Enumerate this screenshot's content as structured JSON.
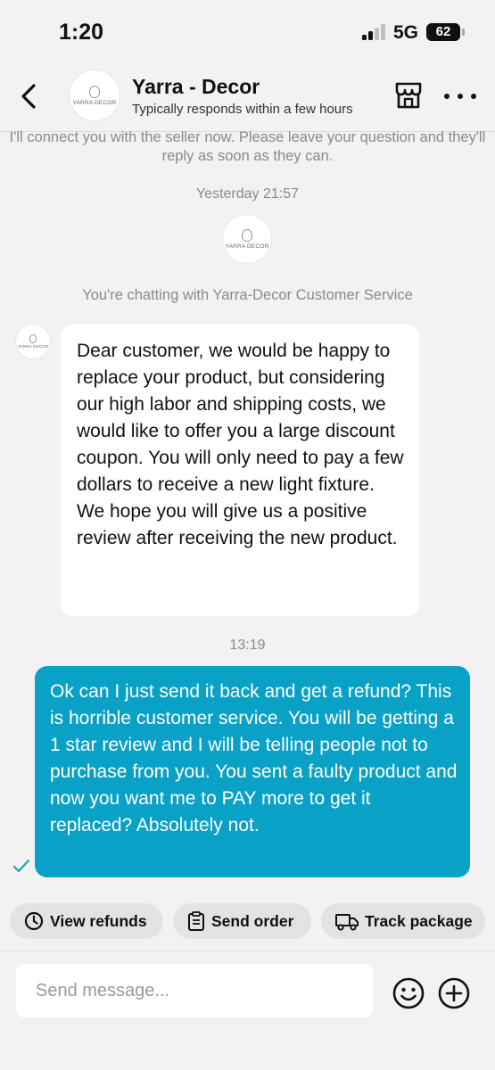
{
  "status_bar": {
    "time": "1:20",
    "network": "5G",
    "battery": "62",
    "battery_level_percent": 62,
    "signal_bars": 2
  },
  "header": {
    "shop_name": "Yarra - Decor",
    "subtitle": "Typically responds within a few hours",
    "logo_text": "YARRA DECOR"
  },
  "chat": {
    "system_message": "I'll connect you with the seller now. Please leave your question and they'll reply as soon as they can.",
    "timestamp_1": "Yesterday 21:57",
    "chatting_with": "You're chatting with Yarra-Decor Customer Service",
    "seller_message": "Dear customer, we would be happy to replace your product, but considering our high labor and shipping costs, we would like to offer you a large discount coupon. You will only need to pay a few dollars to receive a new light fixture. We hope you will give us a positive review after receiving the new product.",
    "timestamp_2": "13:19",
    "user_message": "Ok can I just send it back and get a refund? This is horrible customer service. You will be getting a 1 star review and I will be telling people not to purchase from you. You sent a faulty product and now you want me to PAY more to get it replaced? Absolutely not."
  },
  "quick_actions": {
    "view_refunds": "View refunds",
    "send_order": "Send order",
    "track_package": "Track package"
  },
  "composer": {
    "placeholder": "Send message..."
  },
  "colors": {
    "accent": "#0aa1c6",
    "background": "#f2f2f2",
    "delivered_check": "#1fa7b8"
  },
  "icons": [
    "back-arrow-icon",
    "store-icon",
    "more-icon",
    "check-icon",
    "clock-icon",
    "clipboard-icon",
    "truck-icon",
    "emoji-icon",
    "plus-icon"
  ]
}
